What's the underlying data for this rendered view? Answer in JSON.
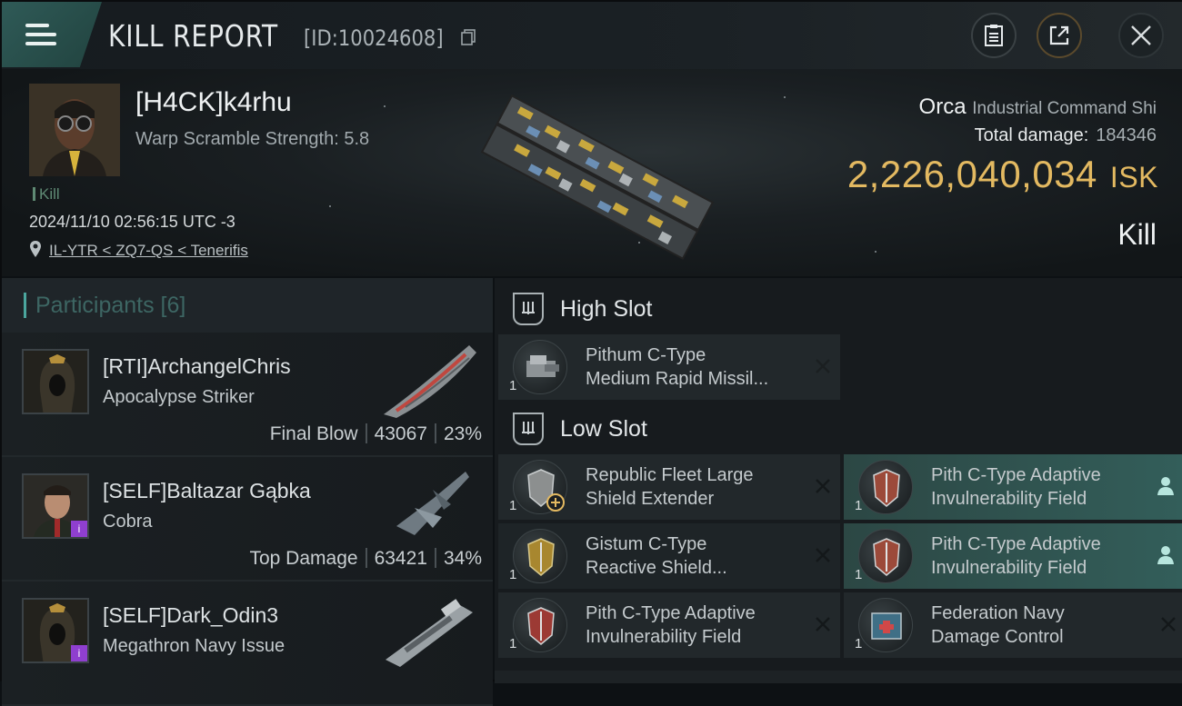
{
  "header": {
    "title": "KILL REPORT",
    "report_id": "[ID:10024608]"
  },
  "victim": {
    "name": "[H4CK]k4rhu",
    "warp_scramble": "Warp Scramble Strength: 5.8",
    "kill_tag": "Kill",
    "timestamp": "2024/11/10 02:56:15 UTC -3",
    "location": "IL-YTR < ZQ7-QS < Tenerifis",
    "ship_name": "Orca",
    "ship_class": "Industrial Command Shi",
    "total_damage_label": "Total damage:",
    "total_damage_value": "184346",
    "isk_value": "2,226,040,034",
    "isk_unit": "ISK",
    "result_label": "Kill"
  },
  "participants": {
    "header": "Participants [6]",
    "rows": [
      {
        "name": "[RTI]ArchangelChris",
        "ship": "Apocalypse Striker",
        "role": "Final Blow",
        "damage": "43067",
        "percent": "23%"
      },
      {
        "name": "[SELF]Baltazar Gąbka",
        "ship": "Cobra",
        "role": "Top Damage",
        "damage": "63421",
        "percent": "34%"
      },
      {
        "name": "[SELF]Dark_Odin3",
        "ship": "Megathron Navy Issue",
        "role": "",
        "damage": "",
        "percent": ""
      }
    ]
  },
  "fitting": {
    "high_slot_label": "High Slot",
    "low_slot_label": "Low Slot",
    "high_slot": [
      {
        "line1": "Pithum C-Type",
        "line2": "Medium Rapid Missil...",
        "qty": "1"
      }
    ],
    "low_slot": [
      {
        "line1": "Republic Fleet Large",
        "line2": "Shield Extender",
        "qty": "1"
      },
      {
        "line1": "Pith C-Type Adaptive",
        "line2": "Invulnerability Field",
        "qty": "1"
      },
      {
        "line1": "Gistum C-Type",
        "line2": "Reactive Shield...",
        "qty": "1"
      },
      {
        "line1": "Pith C-Type Adaptive",
        "line2": "Invulnerability Field",
        "qty": "1"
      },
      {
        "line1": "Pith C-Type Adaptive",
        "line2": "Invulnerability Field",
        "qty": "1"
      },
      {
        "line1": "Federation Navy",
        "line2": "Damage Control",
        "qty": "1"
      }
    ]
  },
  "colors": {
    "accent_teal": "#4ba69e",
    "isk_gold": "#e3b961",
    "highlight_row": "#335e5a"
  }
}
